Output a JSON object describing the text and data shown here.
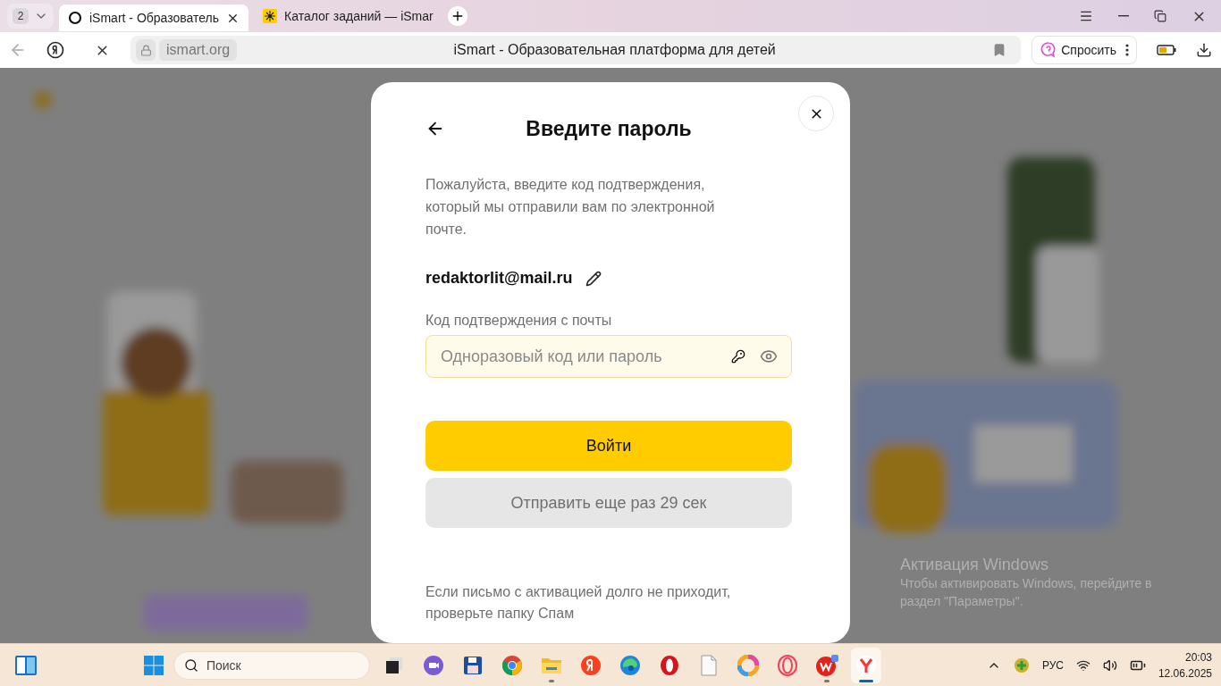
{
  "browser": {
    "tab_count": "2",
    "tabs": [
      {
        "title": "iSmart - Образователь",
        "kind": "ring",
        "selected": true
      },
      {
        "title": "Каталог заданий — iSmar",
        "kind": "sun",
        "selected": false
      }
    ],
    "address": "ismart.org",
    "page_title": "iSmart - Образовательная платформа для детей",
    "ask_button": "Спросить"
  },
  "dialog": {
    "title": "Введите пароль",
    "description": "Пожалуйста, введите код подтверждения, который мы отправили вам по электронной почте.",
    "email": "redaktorlit@mail.ru",
    "field_label": "Код подтверждения с почты",
    "field": {
      "placeholder": "Одноразовый код или пароль"
    },
    "primary_button": "Войти",
    "secondary_button": {
      "label": "Отправить еще раз 29 сек",
      "disabled": true
    },
    "footer_note": "Если письмо с активацией долго не приходит, проверьте папку Спам"
  },
  "activation_notice": {
    "title": "Активация Windows",
    "text": "Чтобы активировать Windows, перейдите в раздел \"Параметры\"."
  },
  "taskbar": {
    "search": {
      "placeholder": "Поиск"
    },
    "apps": [
      {
        "kind": "taskview",
        "running": false,
        "active": false
      },
      {
        "kind": "meet",
        "running": false,
        "active": false
      },
      {
        "kind": "save",
        "running": false,
        "active": false
      },
      {
        "kind": "chrome",
        "running": false,
        "active": false
      },
      {
        "kind": "folder",
        "running": true,
        "active": false
      },
      {
        "kind": "yandex",
        "running": false,
        "active": false
      },
      {
        "kind": "edge",
        "running": false,
        "active": false
      },
      {
        "kind": "opera",
        "running": false,
        "active": false
      },
      {
        "kind": "file",
        "running": false,
        "active": false
      },
      {
        "kind": "photos",
        "running": false,
        "active": false
      },
      {
        "kind": "operagx",
        "running": false,
        "active": false
      },
      {
        "kind": "wps",
        "running": true,
        "active": false
      },
      {
        "kind": "ybrowser",
        "running": true,
        "active": true
      }
    ],
    "language": "РУС",
    "time": "20:03",
    "date": "12.06.2025"
  }
}
